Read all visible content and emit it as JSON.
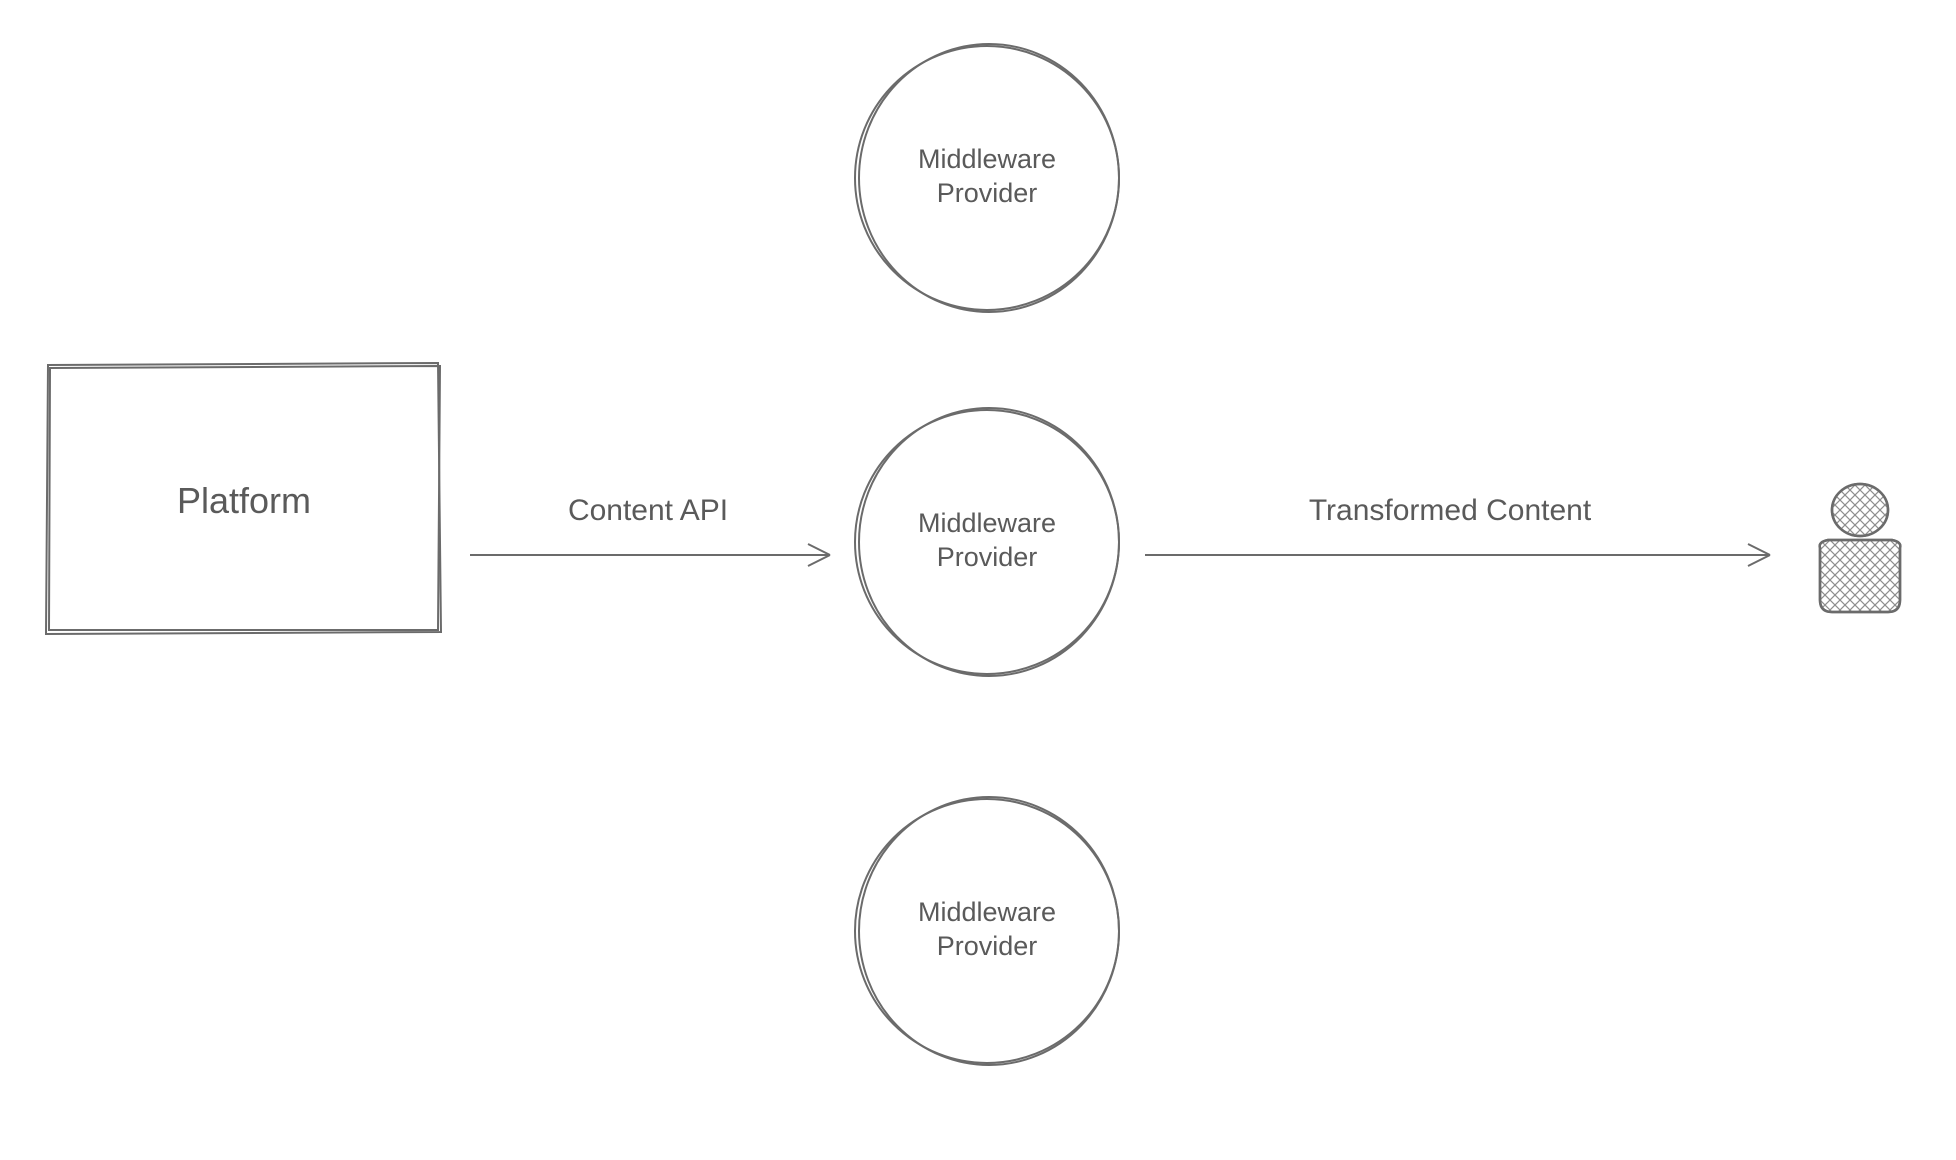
{
  "nodes": {
    "platform": {
      "label": "Platform"
    },
    "middleware_top": {
      "label": "Middleware\nProvider"
    },
    "middleware_middle": {
      "label": "Middleware\nProvider"
    },
    "middleware_bottom": {
      "label": "Middleware\nProvider"
    }
  },
  "arrows": {
    "content_api": {
      "label": "Content API"
    },
    "transformed_content": {
      "label": "Transformed Content"
    }
  },
  "style": {
    "stroke": "#6b6b6b",
    "hatch": "#8e8e8e"
  }
}
